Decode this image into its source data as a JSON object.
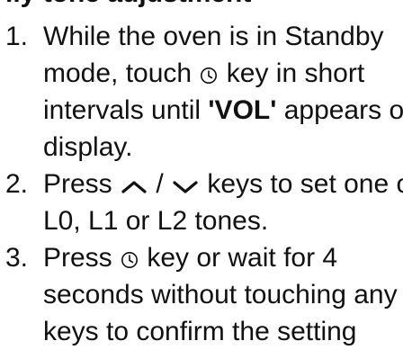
{
  "heading_fragment": "ily tone adjustment",
  "steps": [
    {
      "number": "1.",
      "line1_a": "While the oven is in Standby",
      "line2_a": "mode, touch ",
      "line2_icon": "clock-icon",
      "line2_b": " key in short",
      "line3_a": "intervals until ",
      "line3_bold": "'VOL'",
      "line3_b": " appears on",
      "line4": "display."
    },
    {
      "number": "2.",
      "line1_a": "Press ",
      "up_icon": "chevron-up-icon",
      "slash": " / ",
      "down_icon": "chevron-down-icon",
      "line1_b": " keys to set one of",
      "line2": "L0, L1 or L2 tones."
    },
    {
      "number": "3.",
      "line1_a": "Press ",
      "line1_icon": "clock-icon",
      "line1_b": " key or wait for 4",
      "line2": "seconds without touching any",
      "line3": "keys to confirm the setting"
    }
  ]
}
